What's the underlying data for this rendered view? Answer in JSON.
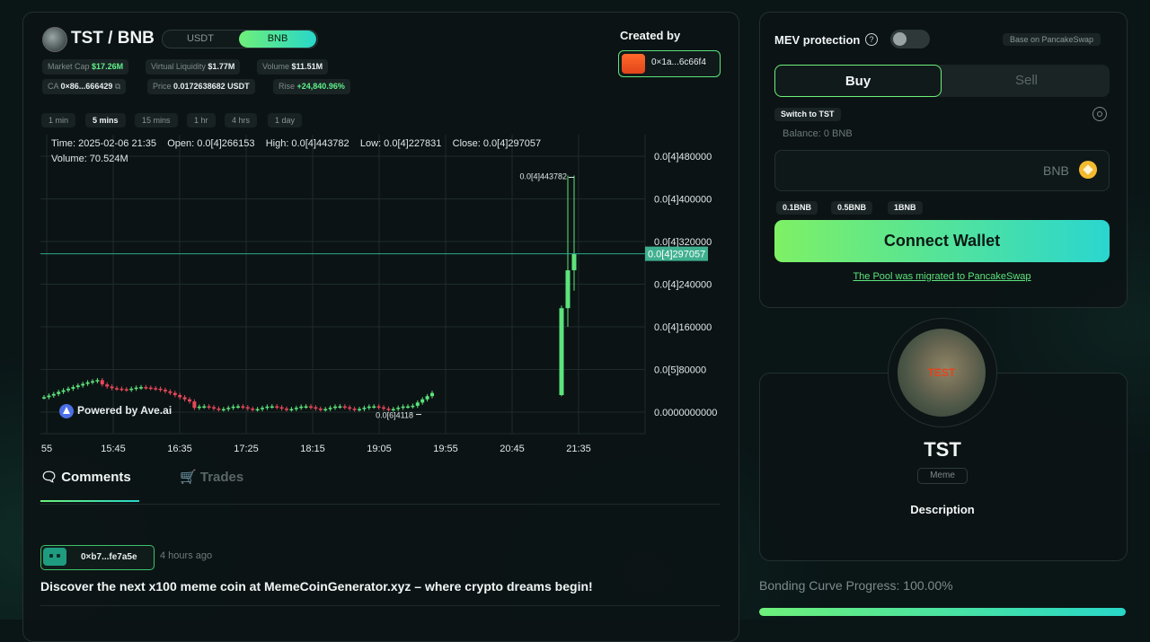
{
  "header": {
    "pair": "TST / BNB",
    "quote_options": [
      "USDT",
      "BNB"
    ],
    "quote_selected": "BNB",
    "created_by_label": "Created by",
    "creator_address": "0×1a...6c66f4"
  },
  "stats": {
    "market_cap_label": "Market Cap",
    "market_cap": "$17.26M",
    "virtual_liquidity_label": "Virtual Liquidity",
    "virtual_liquidity": "$1.77M",
    "volume_label": "Volume",
    "volume": "$11.51M",
    "ca_label": "CA",
    "ca": "0×86...666429",
    "price_label": "Price",
    "price": "0.0172638682 USDT",
    "rise_label": "Rise",
    "rise": "+24,840.96%"
  },
  "timeframes": [
    "1 min",
    "5 mins",
    "15 mins",
    "1 hr",
    "4 hrs",
    "1 day"
  ],
  "timeframe_selected": "5 mins",
  "chart_data": {
    "type": "candlestick",
    "ohlc_text": "Time: 2025-02-06 21:35    Open: 0.0[4]266153    High: 0.0[4]443782    Low: 0.0[4]227831    Close: 0.0[4]297057",
    "volume_text": "Volume: 70.524M",
    "y_ticks": [
      "0.0[4]480000",
      "0.0[4]400000",
      "0.0[4]320000",
      "0.0[4]240000",
      "0.0[4]160000",
      "0.0[5]80000",
      "0.0000000000"
    ],
    "x_ticks": [
      "55",
      "15:45",
      "16:35",
      "17:25",
      "18:15",
      "19:05",
      "19:55",
      "20:45",
      "21:35"
    ],
    "ylim": [
      0,
      4.8e-05
    ],
    "current_price_label": "0.0[4]297057",
    "current_price": 2.97057e-05,
    "high_label": "0.0[4]443782",
    "high_value": 4.43782e-05,
    "low_label": "0.0[6]4118",
    "low_value": 4.118e-07,
    "watermark": "Powered by Ave.ai",
    "colors": {
      "up": "#5de47c",
      "down": "#e8475a",
      "grid": "#1f2b2b",
      "price_line": "#2ea88c"
    }
  },
  "comments_section": {
    "tabs": [
      "Comments",
      "Trades"
    ],
    "active_tab": "Comments",
    "items": [
      {
        "user": "0×b7...fe7a5e",
        "time": "4 hours ago",
        "text": "Discover the next x100 meme coin at MemeCoinGenerator.xyz – where crypto dreams begin!"
      }
    ]
  },
  "trade_panel": {
    "mev_label": "MEV protection",
    "mev_enabled": false,
    "base_label": "Base on PancakeSwap",
    "buy_label": "Buy",
    "sell_label": "Sell",
    "switch_label": "Switch to TST",
    "balance": "Balance: 0 BNB",
    "amount_value": "",
    "unit": "BNB",
    "quick_amounts": [
      "0.1BNB",
      "0.5BNB",
      "1BNB"
    ],
    "connect_label": "Connect Wallet",
    "migrated_text": "The Pool was migrated to PancakeSwap"
  },
  "token_info": {
    "image_text": "TEST",
    "name": "TST",
    "category": "Meme",
    "description_label": "Description",
    "bonding_label": "Bonding Curve Progress: 100.00%",
    "bonding_progress": 1.0
  }
}
